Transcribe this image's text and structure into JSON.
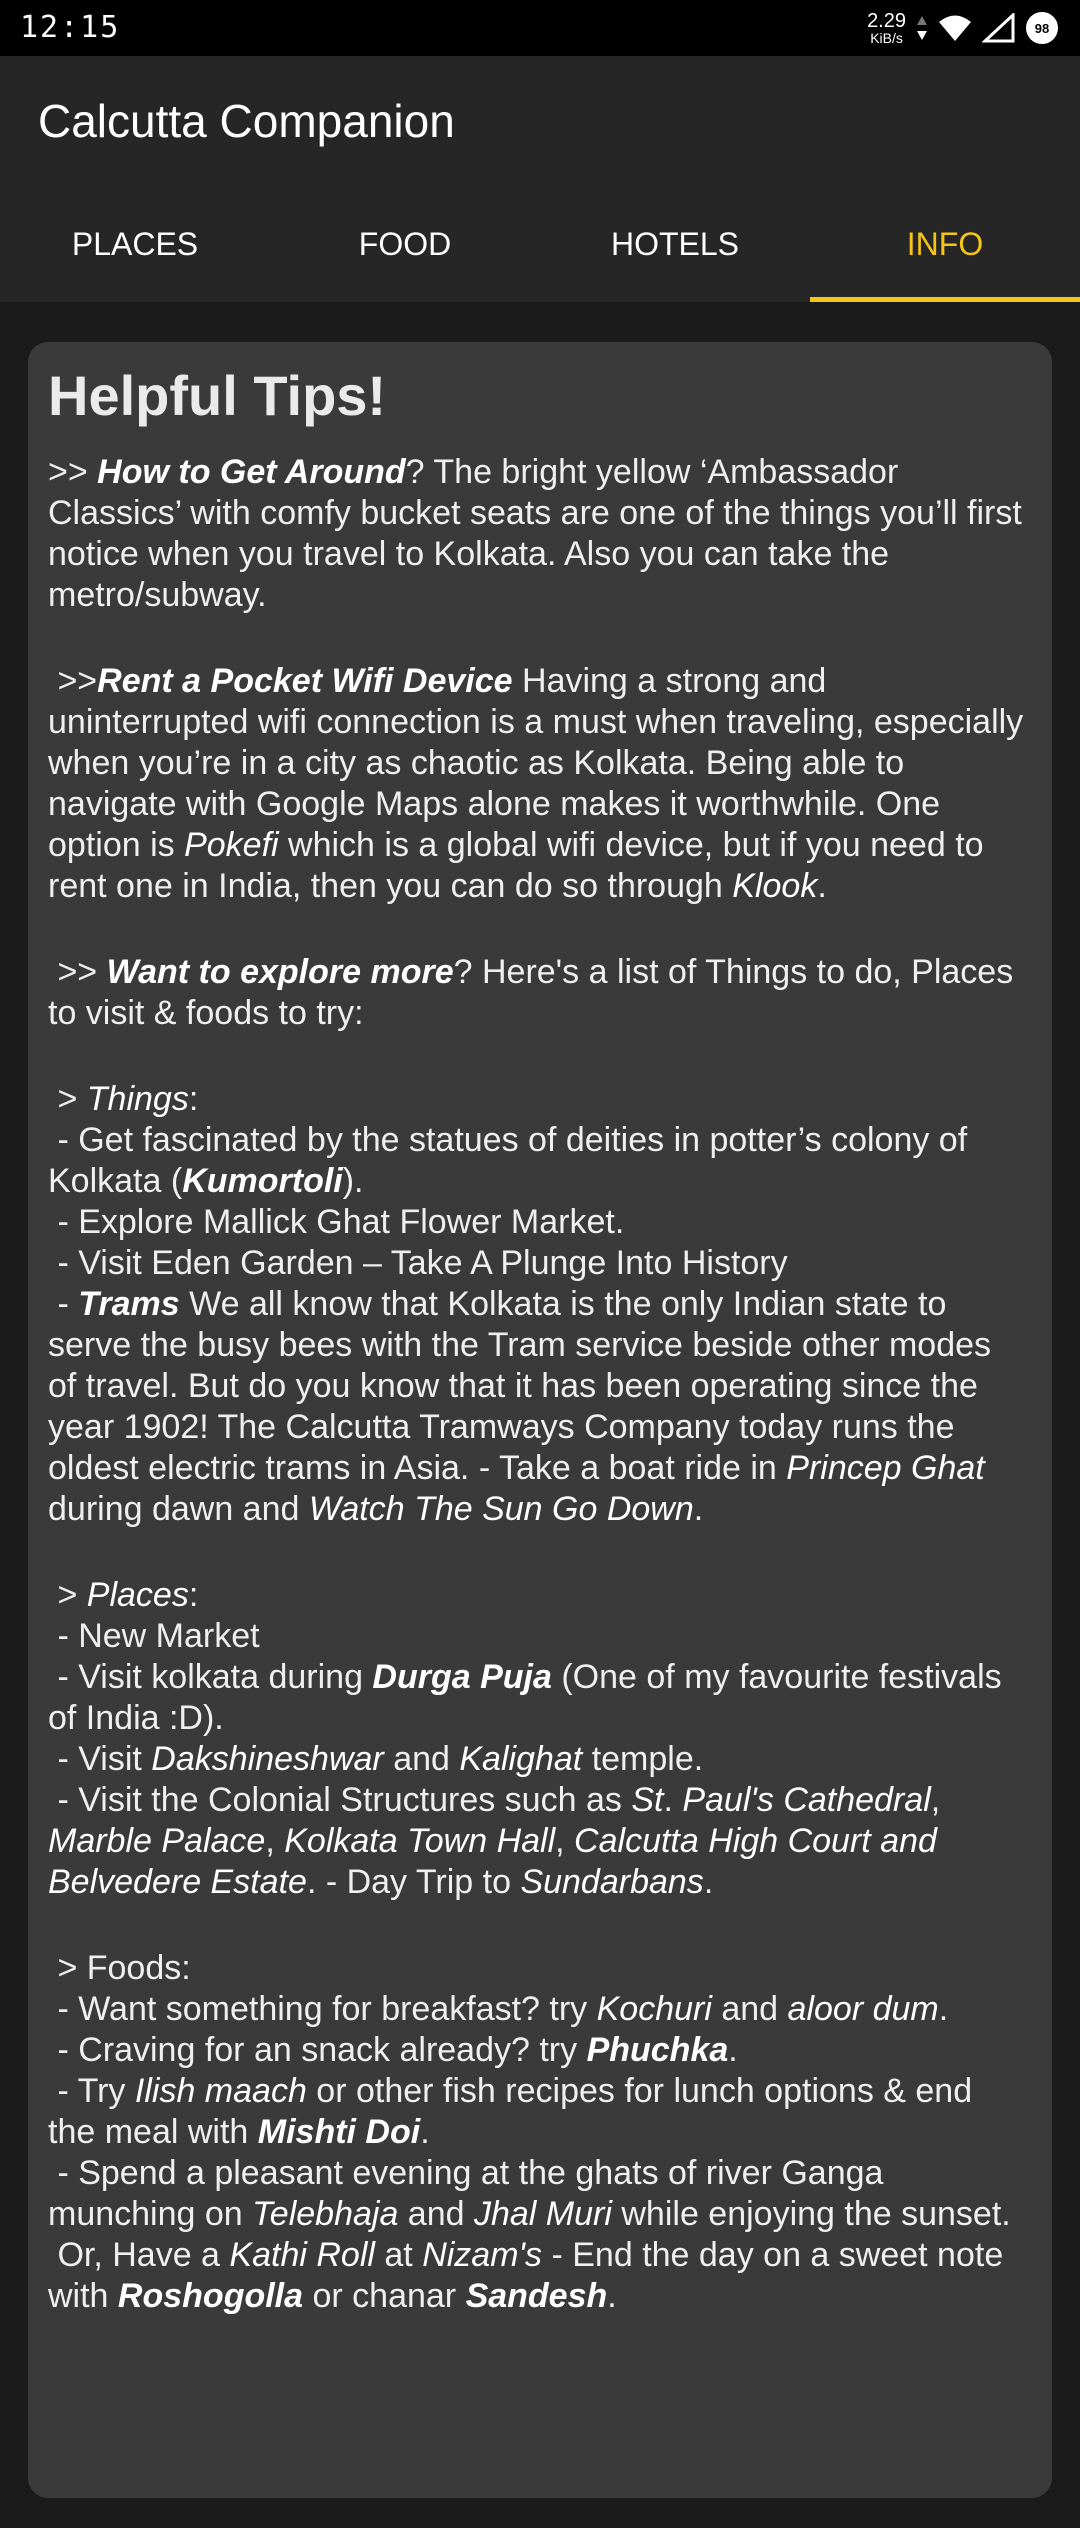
{
  "status": {
    "time": "12:15",
    "speed_value": "2.29",
    "speed_unit": "KiB/s",
    "battery": "98"
  },
  "app": {
    "title": "Calcutta Companion"
  },
  "tabs": [
    {
      "label": "PLACES"
    },
    {
      "label": "FOOD"
    },
    {
      "label": "HOTELS"
    },
    {
      "label": "INFO"
    }
  ],
  "card": {
    "heading": "Helpful Tips!",
    "s1": {
      "prefix": ">> ",
      "title": "How to Get Around",
      "text": "? The bright yellow ‘Ambassador Classics’ with comfy bucket seats are one of the things you’ll first notice when you travel to Kolkata. Also you can take the metro/subway."
    },
    "s2": {
      "prefix": " >>",
      "title": "Rent a Pocket Wifi Device",
      "t1": " Having a strong and uninterrupted wifi connection is a must when traveling, especially when you’re in a city as chaotic as Kolkata. Being able to navigate with Google Maps alone makes it worthwhile. One option is ",
      "e1": "Pokefi",
      "t2": " which is a global wifi device, but if you need to rent one in India, then you can do so through ",
      "e2": "Klook",
      "t3": "."
    },
    "s3": {
      "prefix": " >> ",
      "title": "Want to explore more",
      "text": "? Here's a list of Things to do, Places to visit & foods to try:"
    },
    "things": {
      "prefix": " > ",
      "title": "Things",
      "colon": ":",
      "i1a": " - Get fascinated by the statues of deities in potter’s colony of Kolkata (",
      "i1b": "Kumortoli",
      "i1c": ").",
      "i2": " - Explore Mallick Ghat Flower Market.",
      "i3": " - Visit Eden Garden – Take A Plunge Into History",
      "i4a": " - ",
      "i4b": "Trams",
      "i4c": " We all know that Kolkata is the only Indian state to serve the busy bees with the Tram service beside other modes of travel. But do you know that it has been operating since the year 1902! The Calcutta Tramways Company today runs the oldest electric trams in Asia. - Take a boat ride in ",
      "i4d": "Princep Ghat",
      "i4e": " during dawn and ",
      "i4f": "Watch The Sun Go Down",
      "i4g": "."
    },
    "places": {
      "prefix": " > ",
      "title": "Places",
      "colon": ":",
      "i1": " - New Market",
      "i2a": " - Visit kolkata during ",
      "i2b": "Durga Puja",
      "i2c": " (One of my favourite festivals of India :D).",
      "i3a": " - Visit ",
      "i3b": "Dakshineshwar",
      "i3c": " and ",
      "i3d": "Kalighat",
      "i3e": " temple.",
      "i4a": " - Visit the Colonial Structures such as ",
      "i4b": "St",
      "i4c": ". ",
      "i4d": "Paul's Cathedral",
      "i4e": ", ",
      "i4f": "Marble Palace",
      "i4g": ", ",
      "i4h": "Kolkata Town Hall",
      "i4i": ", ",
      "i4j": "Calcutta High Court and Belvedere Estate",
      "i4k": ". - Day Trip to ",
      "i4l": "Sundarbans",
      "i4m": "."
    },
    "foods": {
      "title": " > Foods:",
      "i1a": " - Want something for breakfast? try ",
      "i1b": "Kochuri",
      "i1c": " and ",
      "i1d": "aloor dum",
      "i1e": ".",
      "i2a": " - Craving for an snack already? try ",
      "i2b": "Phuchka",
      "i2c": ".",
      "i3a": " - Try ",
      "i3b": "Ilish maach",
      "i3c": " or other fish recipes for lunch options & end the meal with ",
      "i3d": "Mishti Doi",
      "i3e": ".",
      "i4a": " - Spend a pleasant evening at the ghats of river Ganga munching on ",
      "i4b": "Telebhaja",
      "i4c": " and ",
      "i4d": "Jhal Muri",
      "i4e": " while enjoying the sunset.",
      "i5a": " Or, Have a ",
      "i5b": "Kathi Roll",
      "i5c": " at ",
      "i5d": "Nizam's",
      "i5e": " - End the day on a sweet note with ",
      "i5f": "Roshogolla",
      "i5g": " or chanar ",
      "i5h": "Sandesh",
      "i5i": "."
    }
  }
}
